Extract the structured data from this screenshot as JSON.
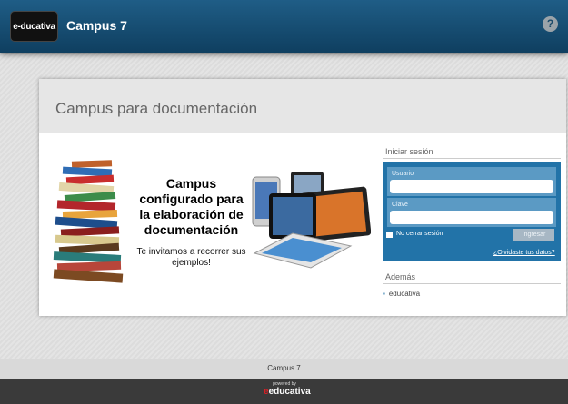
{
  "header": {
    "logo_text": "e-ducativa",
    "title": "Campus 7",
    "help_icon": "?"
  },
  "card": {
    "title": "Campus para documentación"
  },
  "promo": {
    "heading": "Campus configurado para la elaboración de documentación",
    "subtext": "Te invitamos a recorrer sus ejemplos!"
  },
  "login": {
    "title": "Iniciar sesión",
    "user_label": "Usuario",
    "password_label": "Clave",
    "remember_label": "No cerrar sesión",
    "submit_label": "Ingresar",
    "forgot_link": "¿Olvidaste tus datos?"
  },
  "also": {
    "title": "Además",
    "items": [
      "educativa"
    ]
  },
  "footer": {
    "text": "Campus 7",
    "powered_small": "powered by",
    "powered_brand": "educativa"
  },
  "colors": {
    "header_blue": "#1f5d86",
    "login_blue": "#2273a8",
    "brand_red": "#e31e24"
  }
}
